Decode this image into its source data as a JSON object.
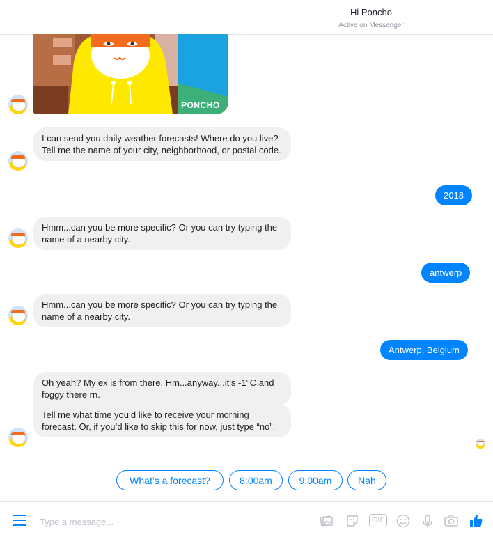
{
  "header": {
    "title": "Hi Poncho",
    "status": "Active on Messenger"
  },
  "card": {
    "brand": "PONCHO"
  },
  "messages": [
    {
      "from": "bot",
      "text": "I can send you daily weather forecasts! Where do you live? Tell me the name of your city, neighborhood, or postal code."
    },
    {
      "from": "user",
      "text": "2018"
    },
    {
      "from": "bot",
      "text": "Hmm...can you be more specific? Or you can try typing the name of a nearby city."
    },
    {
      "from": "user",
      "text": "antwerp"
    },
    {
      "from": "bot",
      "text": "Hmm...can you be more specific? Or you can try typing the name of a nearby city."
    },
    {
      "from": "user",
      "text": "Antwerp, Belgium"
    },
    {
      "from": "bot",
      "text": "Oh yeah? My ex is from there. Hm...anyway...it’s -1°C and foggy there rn."
    },
    {
      "from": "bot",
      "text": "Tell me what time you’d like to receive your morning forecast. Or, if you’d like to skip this for now, just type “no”."
    }
  ],
  "quick_replies": [
    "What’s a forecast?",
    "8:00am",
    "9:00am",
    "Nah"
  ],
  "composer": {
    "placeholder": "Type a message...",
    "gif_label": "GIF"
  },
  "colors": {
    "accent": "#0084ff",
    "bubble_in": "#f1f0f0",
    "poncho_yellow": "#ffe800",
    "poncho_orange": "#f36b1c"
  }
}
